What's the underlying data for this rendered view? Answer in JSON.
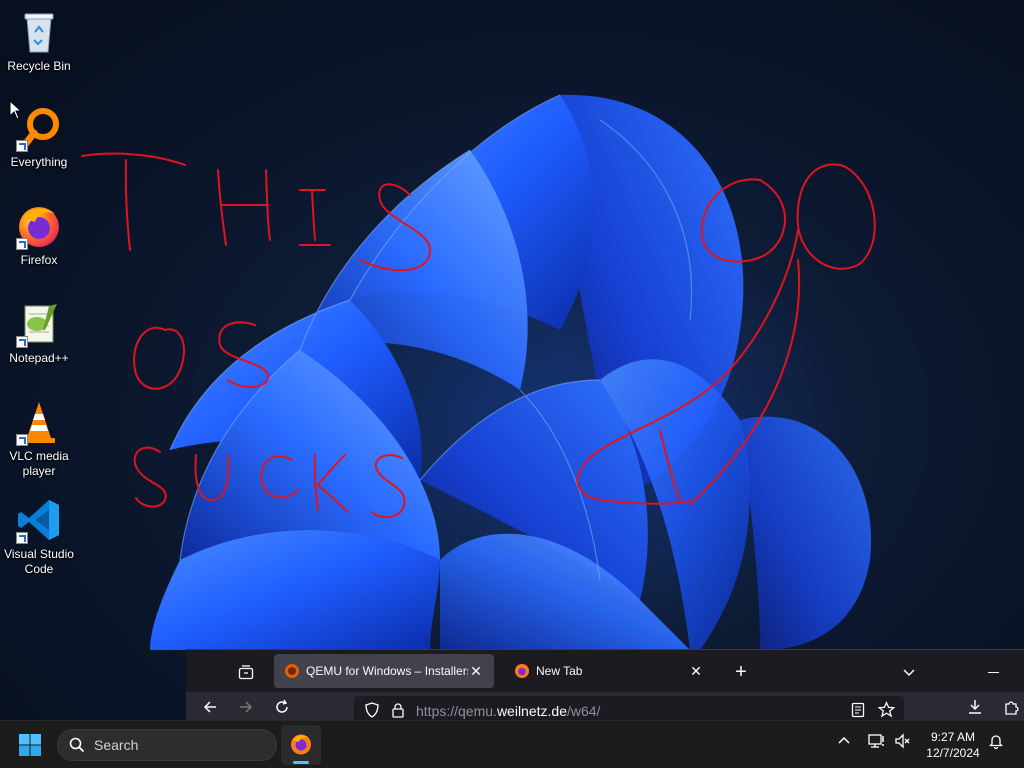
{
  "desktop": {
    "icons": [
      {
        "label": "Recycle Bin",
        "icon": "recycle-bin-icon"
      },
      {
        "label": "Everything",
        "icon": "everything-search-icon"
      },
      {
        "label": "Firefox",
        "icon": "firefox-icon"
      },
      {
        "label": "Notepad++",
        "icon": "notepad-plus-plus-icon"
      },
      {
        "label": "VLC media player",
        "icon": "vlc-cone-icon"
      },
      {
        "label": "Visual Studio Code",
        "icon": "vscode-icon"
      }
    ]
  },
  "colors": {
    "scribble": "#e0141e",
    "wallpaper_bloom": "#1f5cff",
    "taskbar": "#1c1c1c",
    "firefox_tabbar": "#1c1b22",
    "firefox_navbar": "#2b2a33",
    "accent": "#4cc2ff"
  },
  "firefox": {
    "tabs": [
      {
        "title": "QEMU for Windows – Installers",
        "active": true,
        "icon": "qemu-favicon-icon"
      },
      {
        "title": "New Tab",
        "active": false,
        "icon": "firefox-favicon-icon"
      }
    ],
    "url": {
      "prefix": "https://qemu.",
      "domain": "weilnetz.de",
      "path": "/w64/"
    }
  },
  "taskbar": {
    "search_label": "Search",
    "clock": {
      "time": "9:27 AM",
      "date": "12/7/2024"
    }
  }
}
